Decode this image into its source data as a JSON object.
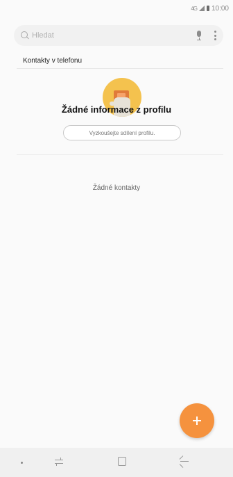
{
  "status_bar": {
    "time": "10:00",
    "signal_label": "4G",
    "icons": [
      "signal-icon",
      "battery-icon"
    ]
  },
  "search": {
    "placeholder": "Hledat",
    "icons": [
      "search-icon",
      "mic-icon",
      "more-icon"
    ]
  },
  "section": {
    "header": "Kontakty v telefonu"
  },
  "profile": {
    "title": "Žádné informace z profilu",
    "share_button_label": "Vyzkoušejte sdílení profilu."
  },
  "contacts": {
    "empty_text": "Žádné kontakty"
  },
  "fab": {
    "icon": "plus-icon",
    "color": "#f5923e"
  },
  "nav_bar": {
    "icons": [
      "nav-dot-icon",
      "recent-apps-icon",
      "home-icon",
      "back-icon"
    ]
  },
  "colors": {
    "accent": "#f5923e",
    "avatar_bg": "#f4c24e"
  }
}
